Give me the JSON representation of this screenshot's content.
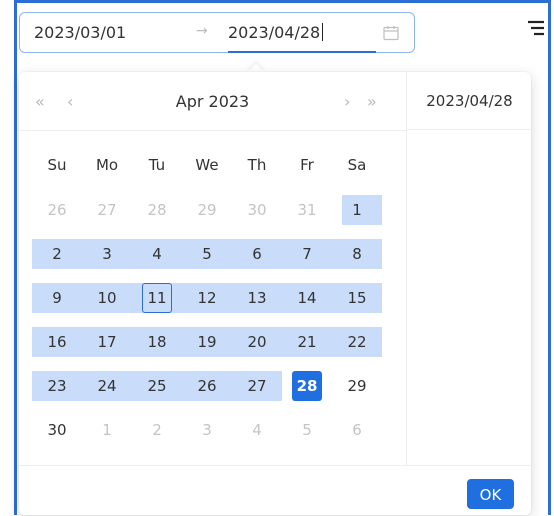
{
  "range": {
    "start": "2023/03/01",
    "separator": "→",
    "end": "2023/04/28"
  },
  "calendar": {
    "prev_year": "«",
    "prev_month": "‹",
    "month_label": "Apr  2023",
    "next_month": "›",
    "next_year": "»",
    "weekdays": [
      "Su",
      "Mo",
      "Tu",
      "We",
      "Th",
      "Fr",
      "Sa"
    ],
    "weeks": [
      [
        "26",
        "27",
        "28",
        "29",
        "30",
        "31",
        "1"
      ],
      [
        "2",
        "3",
        "4",
        "5",
        "6",
        "7",
        "8"
      ],
      [
        "9",
        "10",
        "11",
        "12",
        "13",
        "14",
        "15"
      ],
      [
        "16",
        "17",
        "18",
        "19",
        "20",
        "21",
        "22"
      ],
      [
        "23",
        "24",
        "25",
        "26",
        "27",
        "28",
        "29"
      ],
      [
        "30",
        "1",
        "2",
        "3",
        "4",
        "5",
        "6"
      ]
    ],
    "today": "11",
    "selected_end": "28"
  },
  "sidebar": {
    "date": "2023/04/28"
  },
  "footer": {
    "ok_label": "OK"
  },
  "colors": {
    "accent": "#1f6fe0",
    "range_fill": "#c9dcf9"
  },
  "icons": {
    "calendar": "calendar-icon",
    "filter": "filter-icon"
  }
}
